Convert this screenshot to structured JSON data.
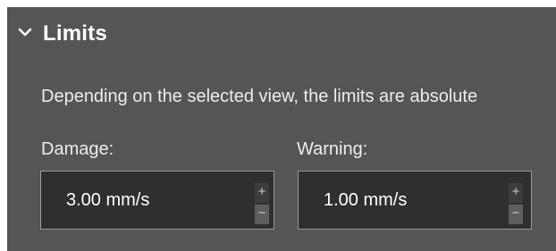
{
  "section": {
    "title": "Limits",
    "expanded": true,
    "icon": "chevron-down-icon"
  },
  "description": "Depending on the selected view, the limits are absolute",
  "fields": {
    "damage": {
      "label": "Damage:",
      "value": "3.00 mm/s",
      "increment_label": "+",
      "decrement_label": "−"
    },
    "warning": {
      "label": "Warning:",
      "value": "1.00 mm/s",
      "increment_label": "+",
      "decrement_label": "−"
    }
  },
  "colors": {
    "panel_background": "#555555",
    "input_background": "#2f2f2f",
    "input_border": "#9a9a9a",
    "text": "#ffffff"
  }
}
